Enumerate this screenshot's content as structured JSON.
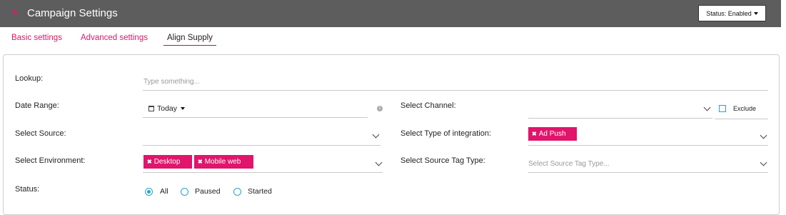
{
  "header": {
    "title": "Campaign Settings",
    "status_label": "Status: Enabled"
  },
  "tabs": [
    {
      "label": "Basic settings"
    },
    {
      "label": "Advanced settings"
    },
    {
      "label": "Align Supply"
    }
  ],
  "form": {
    "lookup": {
      "label": "Lookup:",
      "placeholder": "Type something..."
    },
    "date_range": {
      "label": "Date Range:",
      "value": "Today"
    },
    "channel": {
      "label": "Select Channel:",
      "exclude_label": "Exclude"
    },
    "source": {
      "label": "Select Source:"
    },
    "integration": {
      "label": "Select Type of integration:",
      "tags": [
        "Ad Push"
      ]
    },
    "environment": {
      "label": "Select Environment:",
      "tags": [
        "Desktop",
        "Mobile web"
      ]
    },
    "source_tag": {
      "label": "Select Source Tag Type:",
      "placeholder": "Select Source Tag Type..."
    },
    "status": {
      "label": "Status:",
      "options": [
        "All",
        "Paused",
        "Started"
      ],
      "selected": "All"
    }
  },
  "colors": {
    "accent": "#e0156b",
    "header_bg": "#5d5d5d",
    "radio": "#29a3c8"
  },
  "icons": {
    "collapse": "triangle-right-icon",
    "calendar": "calendar-icon",
    "info": "info-icon",
    "dropdown": "chevron-down-icon",
    "remove": "close-icon"
  }
}
